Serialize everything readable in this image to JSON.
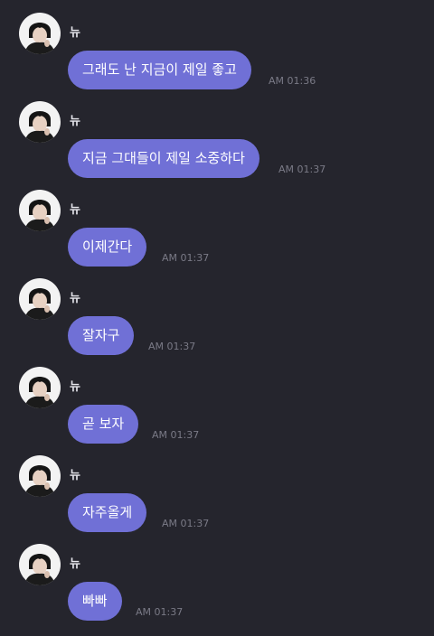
{
  "messages": [
    {
      "sender": "뉴",
      "text": "그래도 난 지금이 제일 좋고",
      "time": "AM 01:36"
    },
    {
      "sender": "뉴",
      "text": "지금 그대들이 제일 소중하다",
      "time": "AM 01:37"
    },
    {
      "sender": "뉴",
      "text": "이제간다",
      "time": "AM 01:37"
    },
    {
      "sender": "뉴",
      "text": "잘자구",
      "time": "AM 01:37"
    },
    {
      "sender": "뉴",
      "text": "곧 보자",
      "time": "AM 01:37"
    },
    {
      "sender": "뉴",
      "text": "자주올게",
      "time": "AM 01:37"
    },
    {
      "sender": "뉴",
      "text": "빠빠",
      "time": "AM 01:37"
    }
  ],
  "colors": {
    "background": "#25252d",
    "bubble": "#7070d6",
    "bubble_text": "#ffffff",
    "sender_text": "#e6e6ec",
    "time_text": "#7a7a86",
    "avatar_bg": "#f3f3f3"
  },
  "icons": {
    "avatar": "profile-photo-avatar-icon"
  }
}
